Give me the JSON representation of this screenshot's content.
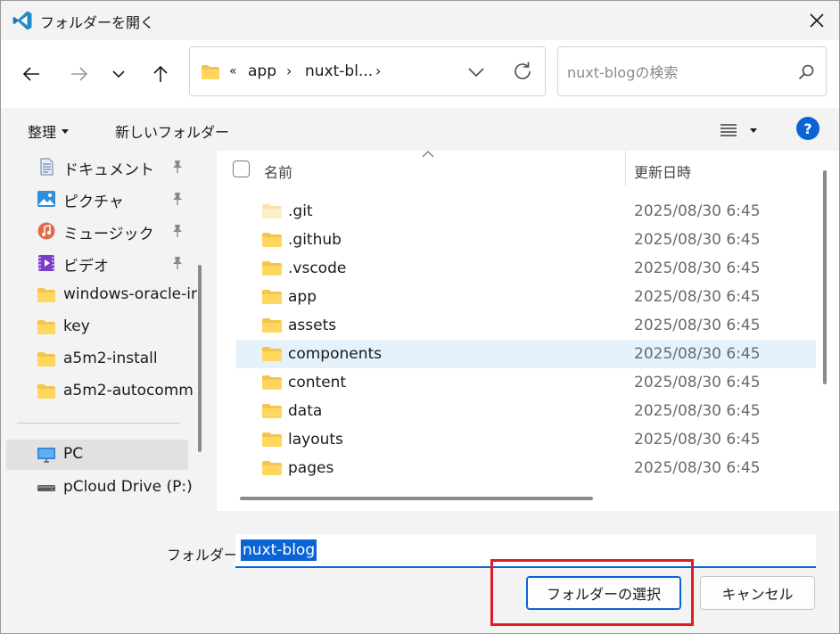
{
  "window": {
    "title": "フォルダーを開く",
    "accent": "#0a64d6"
  },
  "nav": {
    "back_icon": "arrow-left-icon",
    "forward_icon": "arrow-right-icon",
    "recent_icon": "chevron-down-icon",
    "up_icon": "arrow-up-icon"
  },
  "address": {
    "overflow": "«",
    "segments": [
      "app",
      "nuxt-bl..."
    ],
    "separator": "›"
  },
  "search": {
    "placeholder": "nuxt-blogの検索"
  },
  "commands": {
    "organize": "整理",
    "new_folder": "新しいフォルダー",
    "help": "?"
  },
  "sidebar": {
    "items": [
      {
        "label": "ドキュメント",
        "icon": "document-icon",
        "pinned": true
      },
      {
        "label": "ピクチャ",
        "icon": "pictures-icon",
        "pinned": true
      },
      {
        "label": "ミュージック",
        "icon": "music-icon",
        "pinned": true
      },
      {
        "label": "ビデオ",
        "icon": "video-icon",
        "pinned": true
      },
      {
        "label": "windows-oracle-ir",
        "icon": "folder-icon",
        "pinned": false
      },
      {
        "label": "key",
        "icon": "folder-icon",
        "pinned": false
      },
      {
        "label": "a5m2-install",
        "icon": "folder-icon",
        "pinned": false
      },
      {
        "label": "a5m2-autocomm",
        "icon": "folder-icon",
        "pinned": false
      }
    ],
    "devices": [
      {
        "label": "PC",
        "icon": "pc-icon",
        "selected": true
      },
      {
        "label": "pCloud Drive (P:)",
        "icon": "drive-icon",
        "selected": false
      }
    ]
  },
  "columns": {
    "name": "名前",
    "date": "更新日時"
  },
  "files": [
    {
      "name": ".git",
      "date": "2025/08/30 6:45",
      "hidden": true
    },
    {
      "name": ".github",
      "date": "2025/08/30 6:45"
    },
    {
      "name": ".vscode",
      "date": "2025/08/30 6:45"
    },
    {
      "name": "app",
      "date": "2025/08/30 6:45"
    },
    {
      "name": "assets",
      "date": "2025/08/30 6:45"
    },
    {
      "name": "components",
      "date": "2025/08/30 6:45",
      "selected": true
    },
    {
      "name": "content",
      "date": "2025/08/30 6:45"
    },
    {
      "name": "data",
      "date": "2025/08/30 6:45"
    },
    {
      "name": "layouts",
      "date": "2025/08/30 6:45"
    },
    {
      "name": "pages",
      "date": "2025/08/30 6:45"
    }
  ],
  "footer": {
    "folder_label": "フォルダー:",
    "folder_value": "nuxt-blog",
    "select_button": "フォルダーの選択",
    "cancel_button": "キャンセル"
  }
}
